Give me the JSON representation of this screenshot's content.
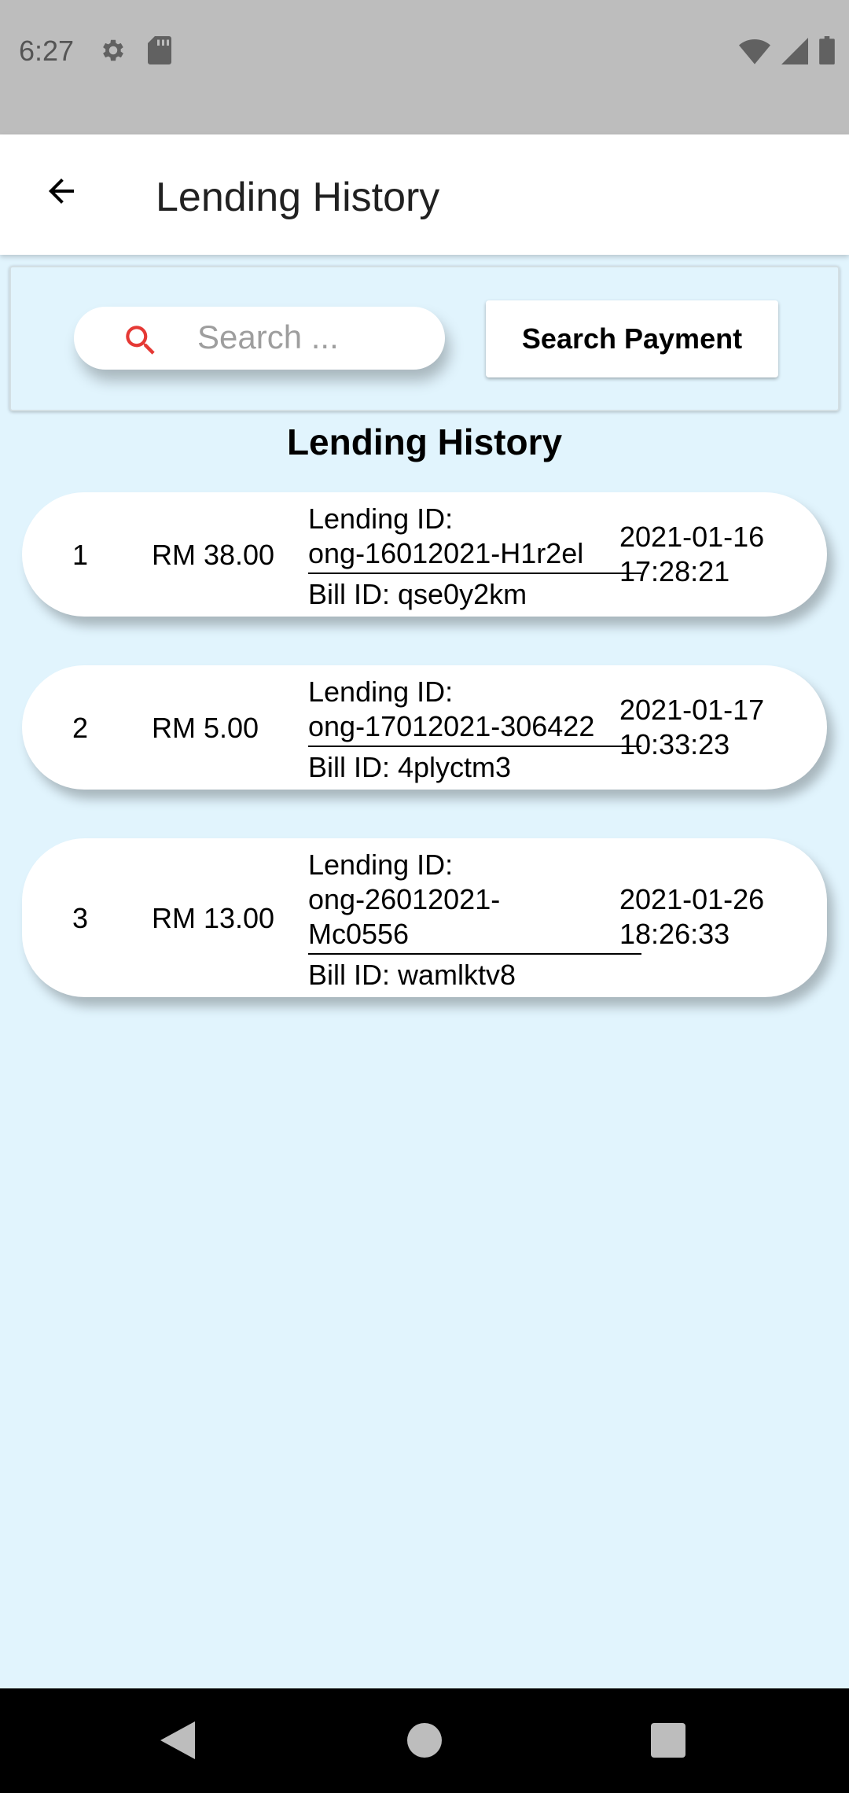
{
  "status_bar": {
    "time": "6:27",
    "left_icons": [
      "gear-icon",
      "sd-card-icon"
    ],
    "right_icons": [
      "wifi-icon",
      "signal-icon",
      "battery-icon"
    ]
  },
  "app_bar": {
    "back_icon": "arrow-left-icon",
    "title": "Lending History"
  },
  "search": {
    "icon": "search-icon",
    "placeholder": "Search ...",
    "value": "",
    "button_label": "Search Payment"
  },
  "section_heading": "Lending History",
  "colors": {
    "background": "#E1F4FD",
    "search_icon": "#E53935",
    "status_bar": "#BDBDBD"
  },
  "records": [
    {
      "index": "1",
      "amount": "RM 38.00",
      "lending_label": "Lending ID:",
      "lending_id": "ong-16012021-H1r2el",
      "bill_label": "Bill ID: qse0y2km",
      "date": "2021-01-16",
      "time": "17:28:21"
    },
    {
      "index": "2",
      "amount": "RM 5.00",
      "lending_label": "Lending ID:",
      "lending_id": "ong-17012021-306422",
      "bill_label": "Bill ID: 4plyctm3",
      "date": "2021-01-17",
      "time": "10:33:23"
    },
    {
      "index": "3",
      "amount": "RM 13.00",
      "lending_label": "Lending ID:",
      "lending_id": "ong-26012021-Mc0556",
      "bill_label": "Bill ID: wamlktv8",
      "date": "2021-01-26",
      "time": "18:26:33"
    }
  ],
  "nav_bar": {
    "icons": [
      "back-triangle-icon",
      "home-circle-icon",
      "recents-square-icon"
    ]
  }
}
